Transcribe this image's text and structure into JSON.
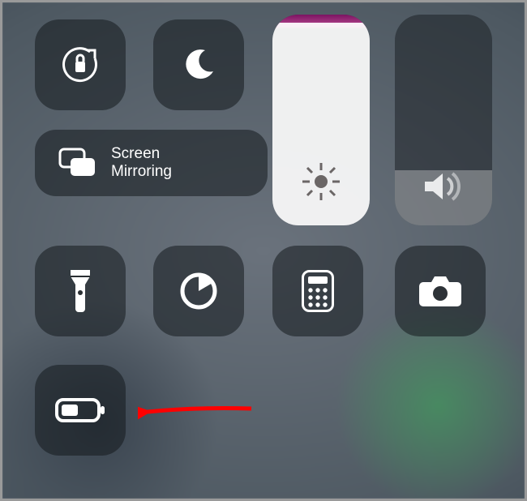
{
  "controls": {
    "orientation_lock": {
      "name": "orientation-lock"
    },
    "do_not_disturb": {
      "name": "do-not-disturb"
    },
    "screen_mirroring": {
      "label": "Screen\nMirroring"
    },
    "flashlight": {
      "name": "flashlight"
    },
    "timer": {
      "name": "timer"
    },
    "calculator": {
      "name": "calculator"
    },
    "camera": {
      "name": "camera"
    },
    "low_power": {
      "name": "low-power-mode"
    }
  },
  "sliders": {
    "brightness": {
      "fill_percent": 96,
      "top_tint": "#b7458f"
    },
    "volume": {
      "fill_percent": 26
    }
  },
  "annotation": {
    "arrow_color": "#ff0000"
  }
}
